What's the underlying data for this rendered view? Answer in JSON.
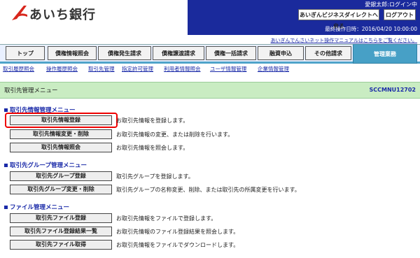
{
  "header": {
    "bank_name": "あいち銀行",
    "user_status": "愛銀太郎:ログイン中",
    "direct_button": "あいぎんビジネスダイレクトへ戻る",
    "logout_button": "ログアウト",
    "last_login": "最終操作日時：2016/04/20 10:00:00",
    "manual_link": "あいぎんでんさいネット操作マニュアルはこちらをご覧ください。"
  },
  "tabs": [
    {
      "label": "トップ"
    },
    {
      "label": "債権情報照会"
    },
    {
      "label": "債権発生請求"
    },
    {
      "label": "債権譲渡請求"
    },
    {
      "label": "債権一括請求"
    },
    {
      "label": "融資申込"
    },
    {
      "label": "その他請求"
    },
    {
      "label": "管理業務"
    }
  ],
  "subnav": [
    {
      "label": "取引履歴照会"
    },
    {
      "label": "操作履歴照会"
    },
    {
      "label": "取引先管理"
    },
    {
      "label": "指定許可管理"
    },
    {
      "label": "利用者情報照会"
    },
    {
      "label": "ユーザ情報管理"
    },
    {
      "label": "企業情報管理"
    }
  ],
  "page": {
    "title": "取引先管理メニュー",
    "screen_id": "SCCMNU12702"
  },
  "sections": [
    {
      "title": "取引先情報管理メニュー",
      "items": [
        {
          "button": "取引先情報登録",
          "desc": "お取引先情報を登録します。"
        },
        {
          "button": "取引先情報変更・削除",
          "desc": "お取引先情報の変更、または削除を行います。"
        },
        {
          "button": "取引先情報照会",
          "desc": "お取引先情報を照会します。"
        }
      ]
    },
    {
      "title": "取引先グループ管理メニュー",
      "items": [
        {
          "button": "取引先グループ登録",
          "desc": "取引先グループを登録します。"
        },
        {
          "button": "取引先グループ変更・削除",
          "desc": "取引先グループの名称変更、削除、または取引先の所属変更を行います。"
        }
      ]
    },
    {
      "title": "ファイル管理メニュー",
      "items": [
        {
          "button": "取引先ファイル登録",
          "desc": "お取引先情報をファイルで登録します。"
        },
        {
          "button": "取引先ファイル登録結果一覧",
          "desc": "お取引先情報のファイル登録結果を照会します。"
        },
        {
          "button": "取引先ファイル取得",
          "desc": "お取引先情報をファイルでダウンロードします。"
        }
      ]
    }
  ],
  "colors": {
    "header_blue": "#1a2a9c",
    "tab_active": "#47a0c6",
    "title_green": "#c9ecc2",
    "highlight": "#e00000"
  }
}
